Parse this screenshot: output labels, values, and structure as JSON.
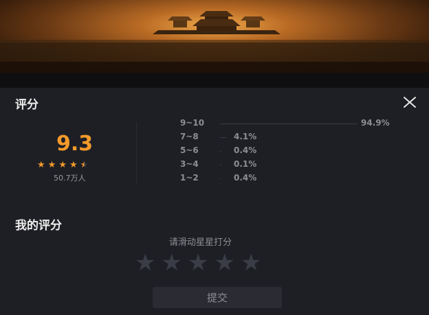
{
  "banner": {
    "image": "palace-at-sunset"
  },
  "panel": {
    "title": "评分",
    "close_icon": "close-icon"
  },
  "rating": {
    "score": "9.3",
    "stars": 4.5,
    "count": "50.7万人",
    "distribution": [
      {
        "range": "9~10",
        "pct": "94.9%",
        "value": 0.949
      },
      {
        "range": "7~8",
        "pct": "4.1%",
        "value": 0.041
      },
      {
        "range": "5~6",
        "pct": "0.4%",
        "value": 0.004
      },
      {
        "range": "3~4",
        "pct": "0.1%",
        "value": 0.001
      },
      {
        "range": "1~2",
        "pct": "0.4%",
        "value": 0.004
      }
    ]
  },
  "my_rating": {
    "title": "我的评分",
    "hint": "请滑动星星打分",
    "star_count": 5,
    "submit_label": "提交"
  },
  "colors": {
    "accent": "#f39a2a",
    "background": "#1e1f25",
    "muted": "#8d8e94"
  }
}
